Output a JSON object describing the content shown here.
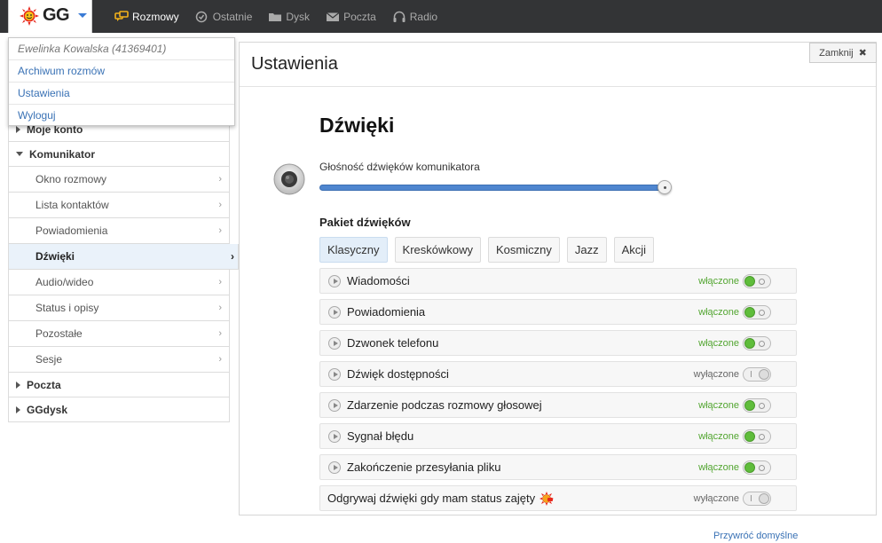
{
  "app": {
    "logo_text": "GG"
  },
  "nav": [
    {
      "label": "Rozmowy",
      "icon": "chat-icon",
      "active": true
    },
    {
      "label": "Ostatnie",
      "icon": "clock-check-icon",
      "active": false
    },
    {
      "label": "Dysk",
      "icon": "folder-icon",
      "active": false
    },
    {
      "label": "Poczta",
      "icon": "envelope-icon",
      "active": false
    },
    {
      "label": "Radio",
      "icon": "headphones-icon",
      "active": false
    }
  ],
  "dropdown": {
    "user": "Ewelinka Kowalska (41369401)",
    "items": [
      "Archiwum rozmów",
      "Ustawienia",
      "Wyloguj"
    ]
  },
  "sidebar": {
    "moje_konto": "Moje konto",
    "komunikator": "Komunikator",
    "sub": [
      "Okno rozmowy",
      "Lista kontaktów",
      "Powiadomienia",
      "Dźwięki",
      "Audio/wideo",
      "Status i opisy",
      "Pozostałe",
      "Sesje"
    ],
    "active_index": 3,
    "poczta": "Poczta",
    "ggdysk": "GGdysk"
  },
  "panel": {
    "title": "Ustawienia",
    "close_label": "Zamknij",
    "section_title": "Dźwięki",
    "volume_label": "Głośność dźwięków komunikatora",
    "volume_value": 100,
    "pack_label": "Pakiet dźwięków",
    "packs": [
      "Klasyczny",
      "Kreskówkowy",
      "Kosmiczny",
      "Jazz",
      "Akcji"
    ],
    "active_pack": "Klasyczny",
    "settings": [
      {
        "label": "Wiadomości",
        "status": "włączone",
        "on": true
      },
      {
        "label": "Powiadomienia",
        "status": "włączone",
        "on": true
      },
      {
        "label": "Dzwonek telefonu",
        "status": "włączone",
        "on": true
      },
      {
        "label": "Dźwięk dostępności",
        "status": "wyłączone",
        "on": false
      },
      {
        "label": "Zdarzenie podczas rozmowy głosowej",
        "status": "włączone",
        "on": true
      },
      {
        "label": "Sygnał błędu",
        "status": "włączone",
        "on": true
      },
      {
        "label": "Zakończenie przesyłania pliku",
        "status": "włączone",
        "on": true
      }
    ],
    "busy_label": "Odgrywaj dźwięki gdy mam status zajęty",
    "busy_status": "wyłączone",
    "restore_label": "Przywróć domyślne"
  },
  "colors": {
    "accent": "#3a72b5",
    "on": "#52a530",
    "topbar": "#333436"
  }
}
